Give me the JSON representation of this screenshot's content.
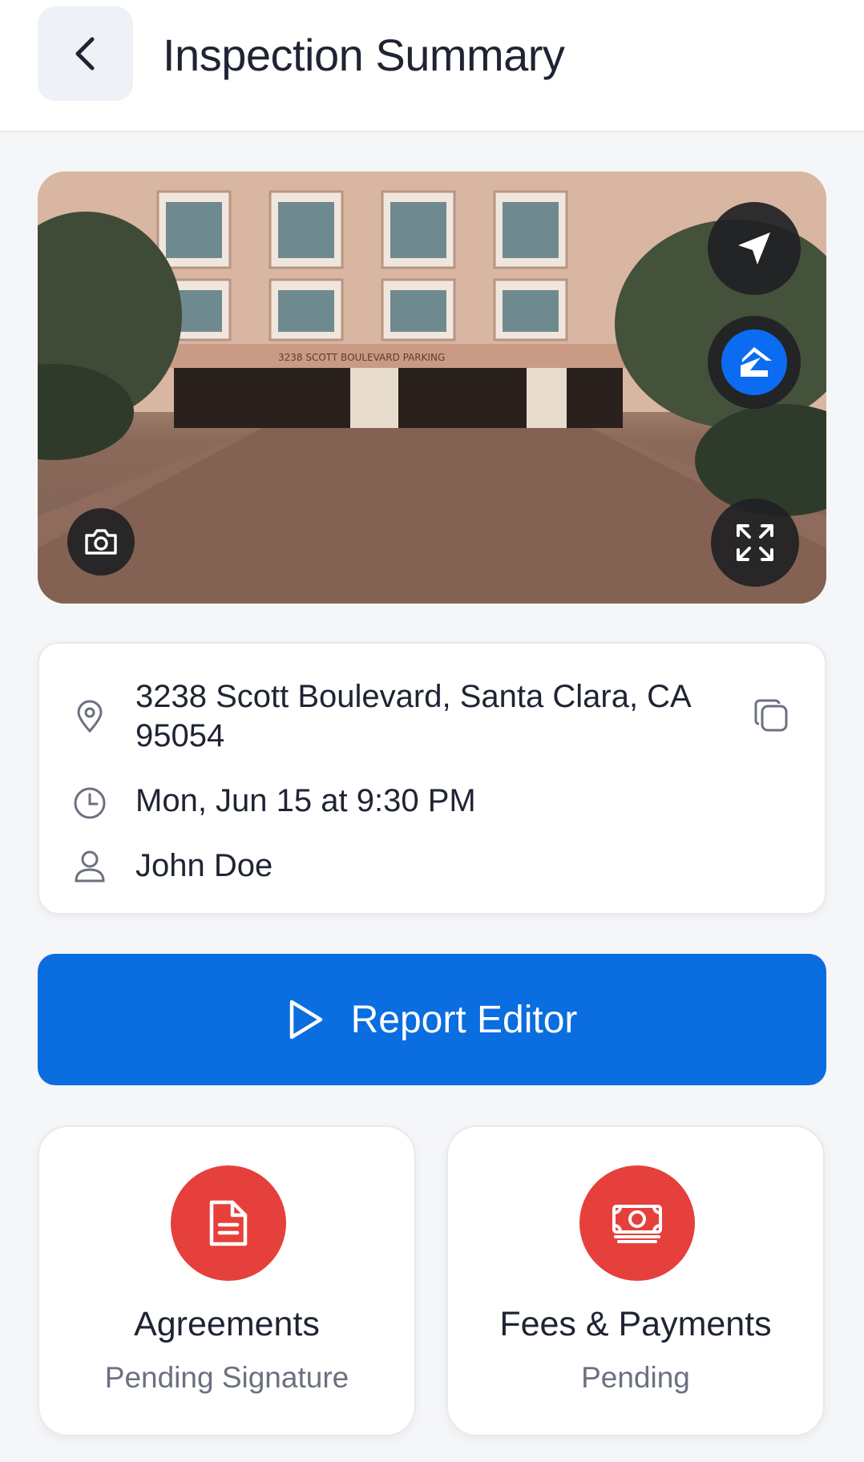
{
  "header": {
    "title": "Inspection Summary",
    "back_icon": "chevron-left-icon"
  },
  "hero": {
    "image": "building-street-view-photo",
    "sign_text": "3238 SCOTT BOULEVARD PARKING",
    "actions": {
      "navigate_icon": "navigation-arrow-icon",
      "zillow_icon": "zillow-icon",
      "zillow_color": "#0b6cf2",
      "expand_icon": "expand-icon",
      "camera_icon": "camera-icon"
    }
  },
  "details": {
    "address": "3238 Scott Boulevard, Santa Clara, CA 95054",
    "datetime": "Mon, Jun 15 at 9:30 PM",
    "client": "John Doe",
    "icons": [
      "map-pin-icon",
      "clock-icon",
      "user-icon",
      "copy-icon"
    ]
  },
  "report_button": {
    "label": "Report Editor",
    "icon": "play-icon",
    "color": "#0a6de0"
  },
  "tiles": [
    {
      "title": "Agreements",
      "status": "Pending Signature",
      "icon": "document-icon",
      "color": "#e5403b"
    },
    {
      "title": "Fees & Payments",
      "status": "Pending",
      "icon": "money-icon",
      "color": "#e5403b"
    }
  ]
}
